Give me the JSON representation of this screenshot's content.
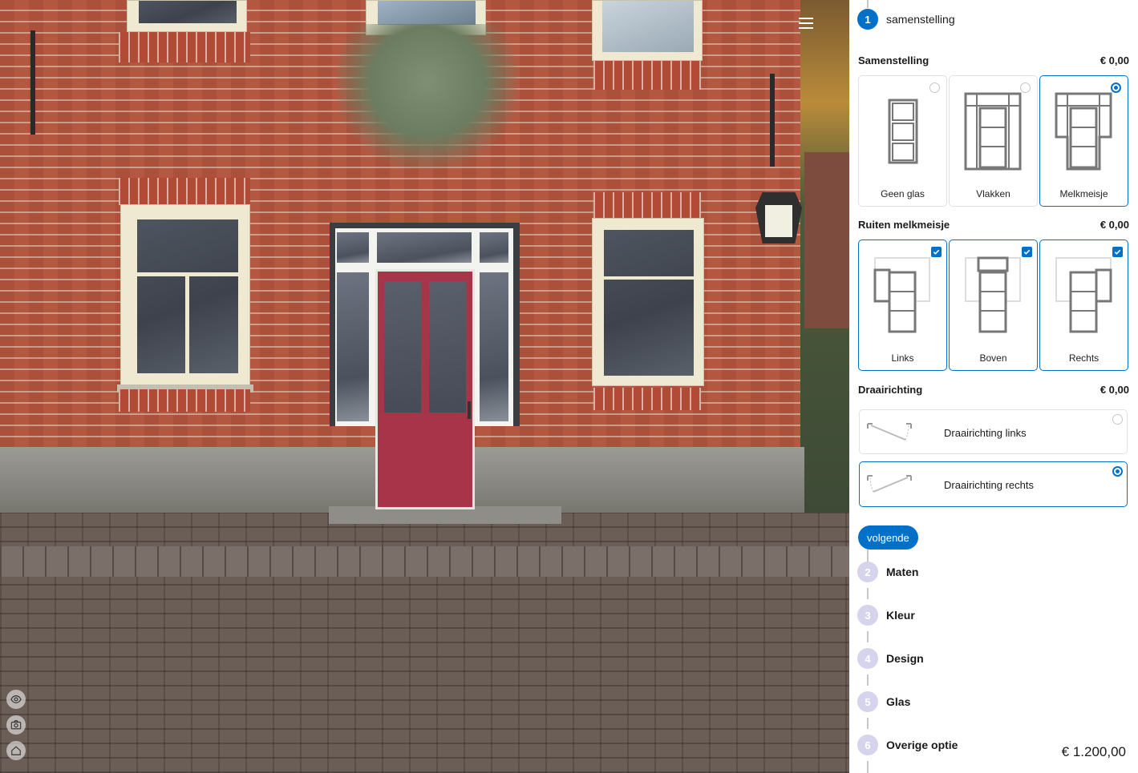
{
  "viewer": {
    "icons": [
      "eye-icon",
      "camera-icon",
      "home-icon"
    ],
    "menu_icon": "hamburger-icon"
  },
  "steps": [
    {
      "number": "1",
      "label": "samenstelling",
      "state": "active"
    },
    {
      "number": "2",
      "label": "Maten",
      "state": "inactive"
    },
    {
      "number": "3",
      "label": "Kleur",
      "state": "inactive"
    },
    {
      "number": "4",
      "label": "Design",
      "state": "inactive"
    },
    {
      "number": "5",
      "label": "Glas",
      "state": "inactive"
    },
    {
      "number": "6",
      "label": "Overige optie",
      "state": "inactive"
    }
  ],
  "samenstelling": {
    "title": "Samenstelling",
    "price": "€ 0,00",
    "options": [
      {
        "label": "Geen glas",
        "selected": false
      },
      {
        "label": "Vlakken",
        "selected": false
      },
      {
        "label": "Melkmeisje",
        "selected": true
      }
    ]
  },
  "ruiten": {
    "title": "Ruiten melkmeisje",
    "price": "€ 0,00",
    "options": [
      {
        "label": "Links",
        "checked": true
      },
      {
        "label": "Boven",
        "checked": true
      },
      {
        "label": "Rechts",
        "checked": true
      }
    ]
  },
  "draairichting": {
    "title": "Draairichting",
    "price": "€ 0,00",
    "options": [
      {
        "label": "Draairichting links",
        "selected": false
      },
      {
        "label": "Draairichting rechts",
        "selected": true
      }
    ]
  },
  "next_label": "volgende",
  "total_price": "€ 1.200,00",
  "colors": {
    "accent": "#0070c9",
    "step_inactive": "#d6d3ec",
    "door": "#a83449"
  }
}
